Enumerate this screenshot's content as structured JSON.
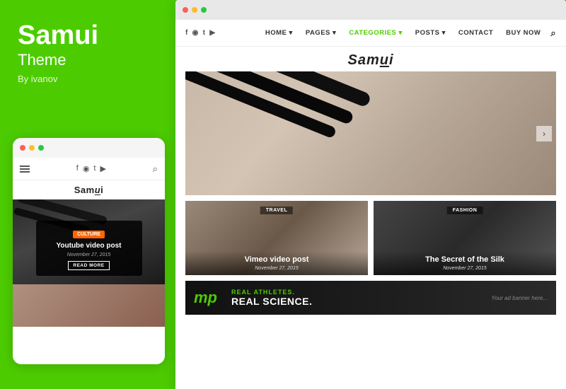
{
  "brand": {
    "title": "Samui",
    "subtitle": "Theme",
    "author": "By ivanov"
  },
  "mobile_mockup": {
    "logo": "Samui",
    "tag": "Culture",
    "card_title": "Youtube video post",
    "card_date": "November 27, 2015",
    "read_more": "READ MORE"
  },
  "browser": {
    "nav": {
      "social_icons": [
        "f",
        "◉",
        "t",
        "▶"
      ],
      "items": [
        {
          "label": "HOME ▾",
          "id": "home"
        },
        {
          "label": "PAGES ▾",
          "id": "pages"
        },
        {
          "label": "CATEGORIES ▾",
          "id": "categories"
        },
        {
          "label": "POSTS ▾",
          "id": "posts"
        },
        {
          "label": "CONTACT",
          "id": "contact"
        },
        {
          "label": "BUY NOW",
          "id": "buy-now"
        }
      ]
    },
    "site_logo": "Samui",
    "posts": [
      {
        "tag": "TRAVEL",
        "title": "Vimeo video post",
        "date": "November 27, 2015"
      },
      {
        "tag": "FASHION",
        "title": "The Secret of the Silk",
        "date": "November 27, 2015"
      }
    ],
    "ad": {
      "badge": "mp",
      "line1": "REAL ATHLETES.",
      "line2": "REAL SCIENCE.",
      "right_text": "Your ad banner here..."
    }
  },
  "dots": {
    "colors": [
      "#ff5f57",
      "#ffbd2e",
      "#28c940"
    ]
  }
}
